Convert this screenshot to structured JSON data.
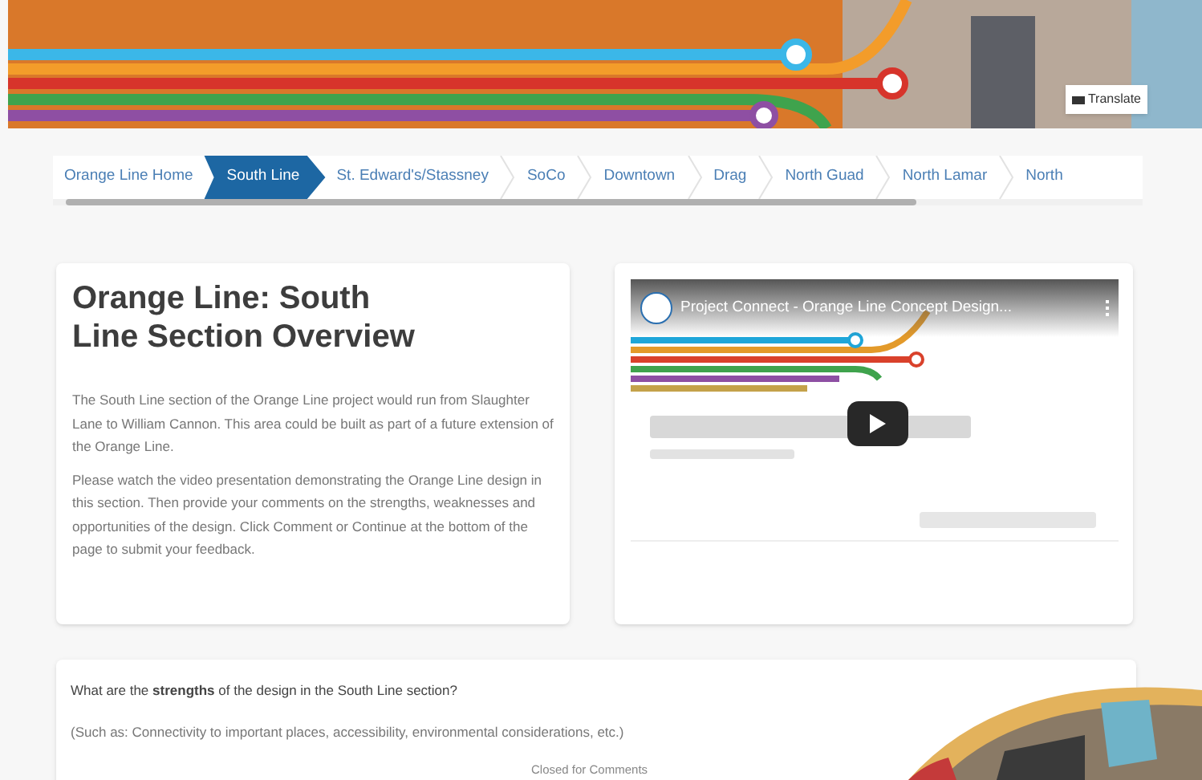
{
  "banner": {
    "translate_button": "Translate"
  },
  "steps": [
    {
      "label": "Orange Line Home",
      "selected": false
    },
    {
      "label": "South Line",
      "selected": true
    },
    {
      "label": "St. Edward's/Stassney",
      "selected": false
    },
    {
      "label": "SoCo",
      "selected": false
    },
    {
      "label": "Downtown",
      "selected": false
    },
    {
      "label": "Drag",
      "selected": false
    },
    {
      "label": "North Guad",
      "selected": false
    },
    {
      "label": "North Lamar",
      "selected": false
    },
    {
      "label": "North",
      "selected": false
    }
  ],
  "overview": {
    "title": "Orange Line: South Line Section Overview",
    "paragraphs": [
      "The South Line section of the Orange Line project would run from Slaughter Lane to William Cannon. This area could be built as part of a future extension of the Orange Line.",
      "Please watch the video presentation demonstrating the Orange Line design in this section. Then provide your comments on the strengths, weaknesses and opportunities of the design. Click Comment or Continue at the bottom of the page to submit your feedback."
    ]
  },
  "video": {
    "title": "Project Connect - Orange Line Concept Design..."
  },
  "question": {
    "prompt": "What are the **strengths** of the design in the South Line section?",
    "hint": "(Such as: Connectivity to important places, accessibility, environmental considerations, etc.)",
    "status": "Closed for Comments"
  }
}
